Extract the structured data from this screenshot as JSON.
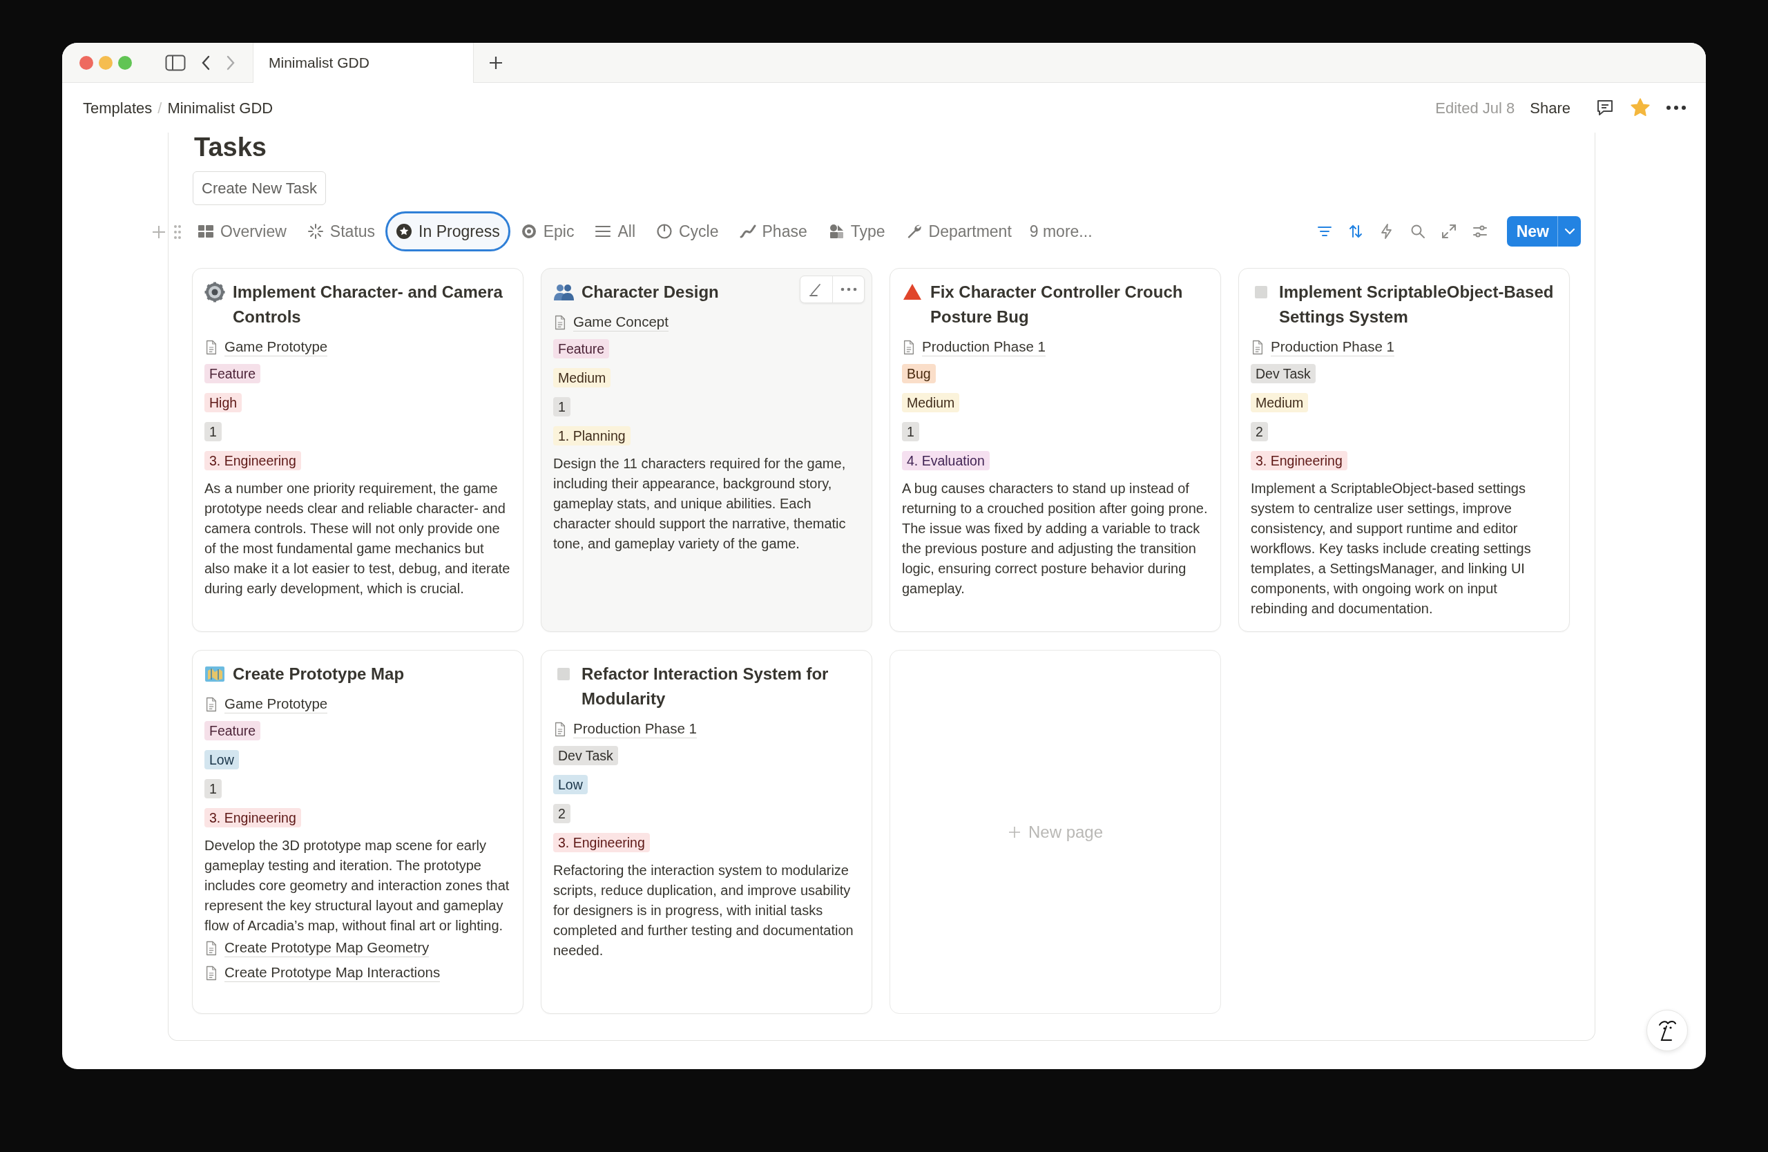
{
  "window": {
    "tab_title": "Minimalist GDD"
  },
  "breadcrumbs": [
    {
      "kind": "link",
      "label": "Templates"
    },
    {
      "kind": "separator",
      "label": "/"
    },
    {
      "kind": "link",
      "label": "Minimalist GDD"
    }
  ],
  "header": {
    "edited": "Edited Jul 8",
    "share": "Share",
    "favorited": true
  },
  "page": {
    "title": "Tasks",
    "create_button": "Create New Task"
  },
  "views": [
    {
      "kind": "table",
      "label": "Overview",
      "selected": false
    },
    {
      "kind": "status",
      "label": "Status",
      "selected": false
    },
    {
      "kind": "progress",
      "label": "In Progress",
      "selected": true
    },
    {
      "kind": "target",
      "label": "Epic",
      "selected": false
    },
    {
      "kind": "list",
      "label": "All",
      "selected": false
    },
    {
      "kind": "cycle",
      "label": "Cycle",
      "selected": false
    },
    {
      "kind": "phase",
      "label": "Phase",
      "selected": false
    },
    {
      "kind": "shapes",
      "label": "Type",
      "selected": false
    },
    {
      "kind": "wrench",
      "label": "Department",
      "selected": false
    },
    {
      "kind": "more",
      "label": "9 more...",
      "selected": false
    }
  ],
  "tools": [
    {
      "kind": "filter",
      "active": true
    },
    {
      "kind": "sort",
      "active": true
    },
    {
      "kind": "automation",
      "active": false
    },
    {
      "kind": "search",
      "active": false
    },
    {
      "kind": "expand",
      "active": false
    },
    {
      "kind": "settings",
      "active": false
    }
  ],
  "new_button": {
    "label": "New"
  },
  "cards": [
    {
      "kind": "gear",
      "title": "Implement Character- and Camera Controls",
      "hovered": false,
      "relation": "Game Prototype",
      "tags": [
        {
          "label": "Feature",
          "color": "#f5e0e9"
        },
        {
          "label": "High",
          "color": "#fbe4e4"
        },
        {
          "label": "1",
          "color": "#e3e2e0"
        },
        {
          "label": "3. Engineering",
          "color": "#fbe4e4"
        }
      ],
      "description": "As a number one priority requirement, the game prototype needs clear and reliable character- and camera controls. These will not only provide one of the most fundamental game mechanics but also make it a lot easier to test, debug, and iterate during early development, which is crucial."
    },
    {
      "kind": "people",
      "title": "Character Design",
      "hovered": true,
      "relation": "Game Concept",
      "tags": [
        {
          "label": "Feature",
          "color": "#f5e0e9"
        },
        {
          "label": "Medium",
          "color": "#fbf3db"
        },
        {
          "label": "1",
          "color": "#e3e2e0"
        },
        {
          "label": "1. Planning",
          "color": "#fbf3db"
        }
      ],
      "description": "Design the 11 characters required for the game, including their appearance, background story, gameplay stats, and unique abilities. Each character should support the narrative, thematic tone, and gameplay variety of the game."
    },
    {
      "kind": "triangle",
      "title": "Fix Character Controller Crouch Posture Bug",
      "hovered": false,
      "relation": "Production Phase 1",
      "tags": [
        {
          "label": "Bug",
          "color": "#fadec9"
        },
        {
          "label": "Medium",
          "color": "#fbf3db"
        },
        {
          "label": "1",
          "color": "#e3e2e0"
        },
        {
          "label": "4. Evaluation",
          "color": "#f5e0f0"
        }
      ],
      "description": "A bug causes characters to stand up instead of returning to a crouched position after going prone. The issue was fixed by adding a variable to track the previous posture and adjusting the transition logic, ensuring correct posture behavior during gameplay."
    },
    {
      "kind": "square",
      "title": "Implement ScriptableObject-Based Settings System",
      "hovered": false,
      "relation": "Production Phase 1",
      "tags": [
        {
          "label": "Dev Task",
          "color": "#e3e2e0"
        },
        {
          "label": "Medium",
          "color": "#fbf3db"
        },
        {
          "label": "2",
          "color": "#e3e2e0"
        },
        {
          "label": "3. Engineering",
          "color": "#fbe4e4"
        }
      ],
      "description": "Implement a ScriptableObject-based settings system to centralize user settings, improve consistency, and support runtime and editor workflows. Key tasks include creating settings templates, a SettingsManager, and linking UI components, with ongoing work on input rebinding and documentation."
    },
    {
      "kind": "map",
      "title": "Create Prototype Map",
      "hovered": false,
      "relation": "Game Prototype",
      "tags": [
        {
          "label": "Feature",
          "color": "#f5e0e9"
        },
        {
          "label": "Low",
          "color": "#d3e5ef"
        },
        {
          "label": "1",
          "color": "#e3e2e0"
        },
        {
          "label": "3. Engineering",
          "color": "#fbe4e4"
        }
      ],
      "description": "Develop the 3D prototype map scene for early gameplay testing and iteration. The prototype includes core geometry and interaction zones that represent the key structural layout and gameplay flow of Arcadia’s map, without final art or lighting.",
      "subpages": [
        "Create Prototype Map Geometry",
        "Create Prototype Map Interactions"
      ]
    },
    {
      "kind": "square",
      "title": "Refactor Interaction System for Modularity",
      "hovered": false,
      "relation": "Production Phase 1",
      "tags": [
        {
          "label": "Dev Task",
          "color": "#e3e2e0"
        },
        {
          "label": "Low",
          "color": "#d3e5ef"
        },
        {
          "label": "2",
          "color": "#e3e2e0"
        },
        {
          "label": "3. Engineering",
          "color": "#fbe4e4"
        }
      ],
      "description": "Refactoring the interaction system to modularize scripts, reduce duplication, and improve usability for designers is in progress, with initial tasks completed and further testing and documentation needed."
    }
  ],
  "new_page": {
    "label": "New page"
  }
}
